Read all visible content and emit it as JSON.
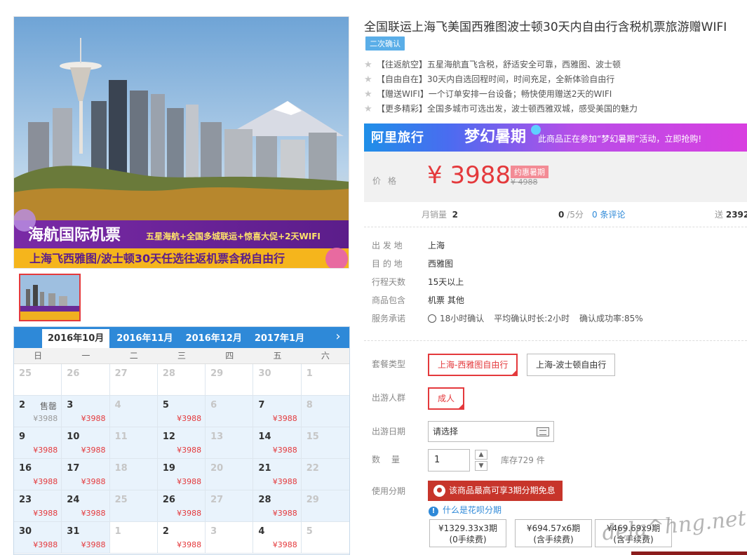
{
  "product": {
    "title": "全国联运上海飞美国西雅图波士顿30天内自由行含税机票旅游赠WIFI",
    "confirm_tag": "二次确认",
    "features": [
      "【往返航空】五星海航直飞含税，舒适安全可靠，西雅图、波士顿",
      "【自由自在】30天内自选回程时间，时间充足，全新体验自由行",
      "【赠送WIFI】一个订单安排一台设备；畅快使用赠送2天的WIFI",
      "【更多精彩】全国多城市可选出发，波士顿西雅双城，感受美国的魅力"
    ]
  },
  "hero": {
    "banner_title": "海航国际机票",
    "banner_sub": "五星海航+全国多城联运+惊喜大促+2天WIFI",
    "banner_route": "上海飞西雅图/波士顿30天任选往返机票含税自由行"
  },
  "promo": {
    "brand": "阿里旅行",
    "campaign": "梦幻暑期",
    "text": "此商品正在参加“梦幻暑期”活动，立即抢购!"
  },
  "price": {
    "label": "价格",
    "current": "¥ 3988",
    "badge": "约惠暑期",
    "original": "¥ 4988"
  },
  "stats": {
    "monthly_label": "月销量",
    "monthly_value": "2",
    "rating_value": "0",
    "rating_suffix": "/5分",
    "reviews": "0 条评论",
    "points_label": "送",
    "points_value": "2392"
  },
  "attributes": [
    {
      "key": "出 发 地",
      "value": "上海"
    },
    {
      "key": "目 的 地",
      "value": "西雅图"
    },
    {
      "key": "行程天数",
      "value": "15天以上"
    },
    {
      "key": "商品包含",
      "value": "机票  其他"
    }
  ],
  "service": {
    "key": "服务承诺",
    "items": [
      "18小时确认",
      "平均确认时长:2小时",
      "确认成功率:85%"
    ]
  },
  "options": {
    "package_label": "套餐类型",
    "packages": [
      "上海-西雅图自由行",
      "上海-波士顿自由行"
    ],
    "traveler_label": "出游人群",
    "traveler": "成人",
    "date_label": "出游日期",
    "date_value": "请选择",
    "qty_label": "数　量",
    "qty_value": "1",
    "stock": "库存729 件",
    "installment_label": "使用分期",
    "huabei_banner": "该商品最高可享3期分期免息",
    "huabei_link": "什么是花呗分期",
    "plans": [
      {
        "amount": "¥1329.33",
        "periods": "x3期",
        "fee": "(0手续费)"
      },
      {
        "amount": "¥694.57",
        "periods": "x6期",
        "fee": "(含手续费)"
      },
      {
        "amount": "¥469.69",
        "periods": "x9期",
        "fee": "(含手续费)"
      }
    ]
  },
  "calendar": {
    "tabs": [
      "2016年10月",
      "2016年11月",
      "2016年12月",
      "2017年1月"
    ],
    "next": "›",
    "weekdays": [
      "日",
      "一",
      "二",
      "三",
      "四",
      "五",
      "六"
    ],
    "cells": [
      {
        "d": "25",
        "g": true
      },
      {
        "d": "26",
        "g": true
      },
      {
        "d": "27",
        "g": true
      },
      {
        "d": "28",
        "g": true
      },
      {
        "d": "29",
        "g": true
      },
      {
        "d": "30",
        "g": true
      },
      {
        "d": "1",
        "g": true
      },
      {
        "d": "2",
        "s": "售罄",
        "p": "¥3988",
        "pg": true
      },
      {
        "d": "3",
        "p": "¥3988"
      },
      {
        "d": "4",
        "g": true
      },
      {
        "d": "5",
        "p": "¥3988"
      },
      {
        "d": "6",
        "g": true
      },
      {
        "d": "7",
        "p": "¥3988"
      },
      {
        "d": "8",
        "g": true
      },
      {
        "d": "9",
        "p": "¥3988"
      },
      {
        "d": "10",
        "p": "¥3988"
      },
      {
        "d": "11",
        "g": true
      },
      {
        "d": "12",
        "p": "¥3988"
      },
      {
        "d": "13",
        "g": true
      },
      {
        "d": "14",
        "p": "¥3988"
      },
      {
        "d": "15",
        "g": true
      },
      {
        "d": "16",
        "p": "¥3988"
      },
      {
        "d": "17",
        "p": "¥3988"
      },
      {
        "d": "18",
        "g": true
      },
      {
        "d": "19",
        "p": "¥3988"
      },
      {
        "d": "20",
        "g": true
      },
      {
        "d": "21",
        "p": "¥3988"
      },
      {
        "d": "22",
        "g": true
      },
      {
        "d": "23",
        "p": "¥3988"
      },
      {
        "d": "24",
        "p": "¥3988"
      },
      {
        "d": "25",
        "g": true
      },
      {
        "d": "26",
        "p": "¥3988"
      },
      {
        "d": "27",
        "g": true
      },
      {
        "d": "28",
        "p": "¥3988"
      },
      {
        "d": "29",
        "g": true
      },
      {
        "d": "30",
        "p": "¥3988"
      },
      {
        "d": "31",
        "p": "¥3988"
      },
      {
        "d": "1",
        "g": true,
        "nc": true
      },
      {
        "d": "2",
        "p": "¥3988",
        "nc": true
      },
      {
        "d": "3",
        "g": true,
        "nc": true
      },
      {
        "d": "4",
        "p": "¥3988",
        "nc": true
      },
      {
        "d": "5",
        "g": true,
        "nc": true
      }
    ]
  },
  "watermark": "dela^hng.net",
  "colors": {
    "accent_red": "#e4393c",
    "link_blue": "#2e89d8",
    "calendar_blue": "#2e89d8",
    "huabei_red": "#c7352b"
  }
}
